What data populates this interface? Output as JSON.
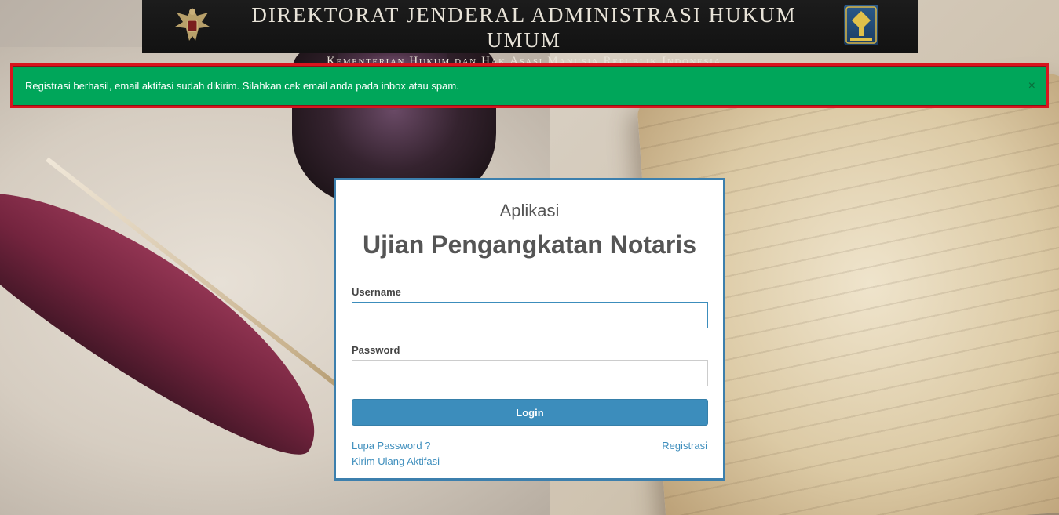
{
  "banner": {
    "title": "DIREKTORAT JENDERAL ADMINISTRASI HUKUM UMUM",
    "subtitle": "Kementerian Hukum dan Hak Asasi Manusia Republik Indonesia"
  },
  "alert": {
    "message": "Registrasi berhasil, email aktifasi sudah dikirim. Silahkan cek email anda pada inbox atau spam.",
    "close_label": "×",
    "color": "#00a65a",
    "border_color": "#d9141e"
  },
  "login": {
    "app_label": "Aplikasi",
    "app_title": "Ujian Pengangkatan Notaris",
    "username_label": "Username",
    "username_value": "",
    "password_label": "Password",
    "password_value": "",
    "login_button": "Login",
    "forgot_link": "Lupa Password ?",
    "register_link": "Registrasi",
    "resend_link": "Kirim Ulang Aktifasi",
    "accent_color": "#3c8dbc"
  },
  "icons": {
    "left_logo": "garuda-emblem-icon",
    "right_logo": "pengayoman-logo-icon",
    "close": "close-icon"
  }
}
